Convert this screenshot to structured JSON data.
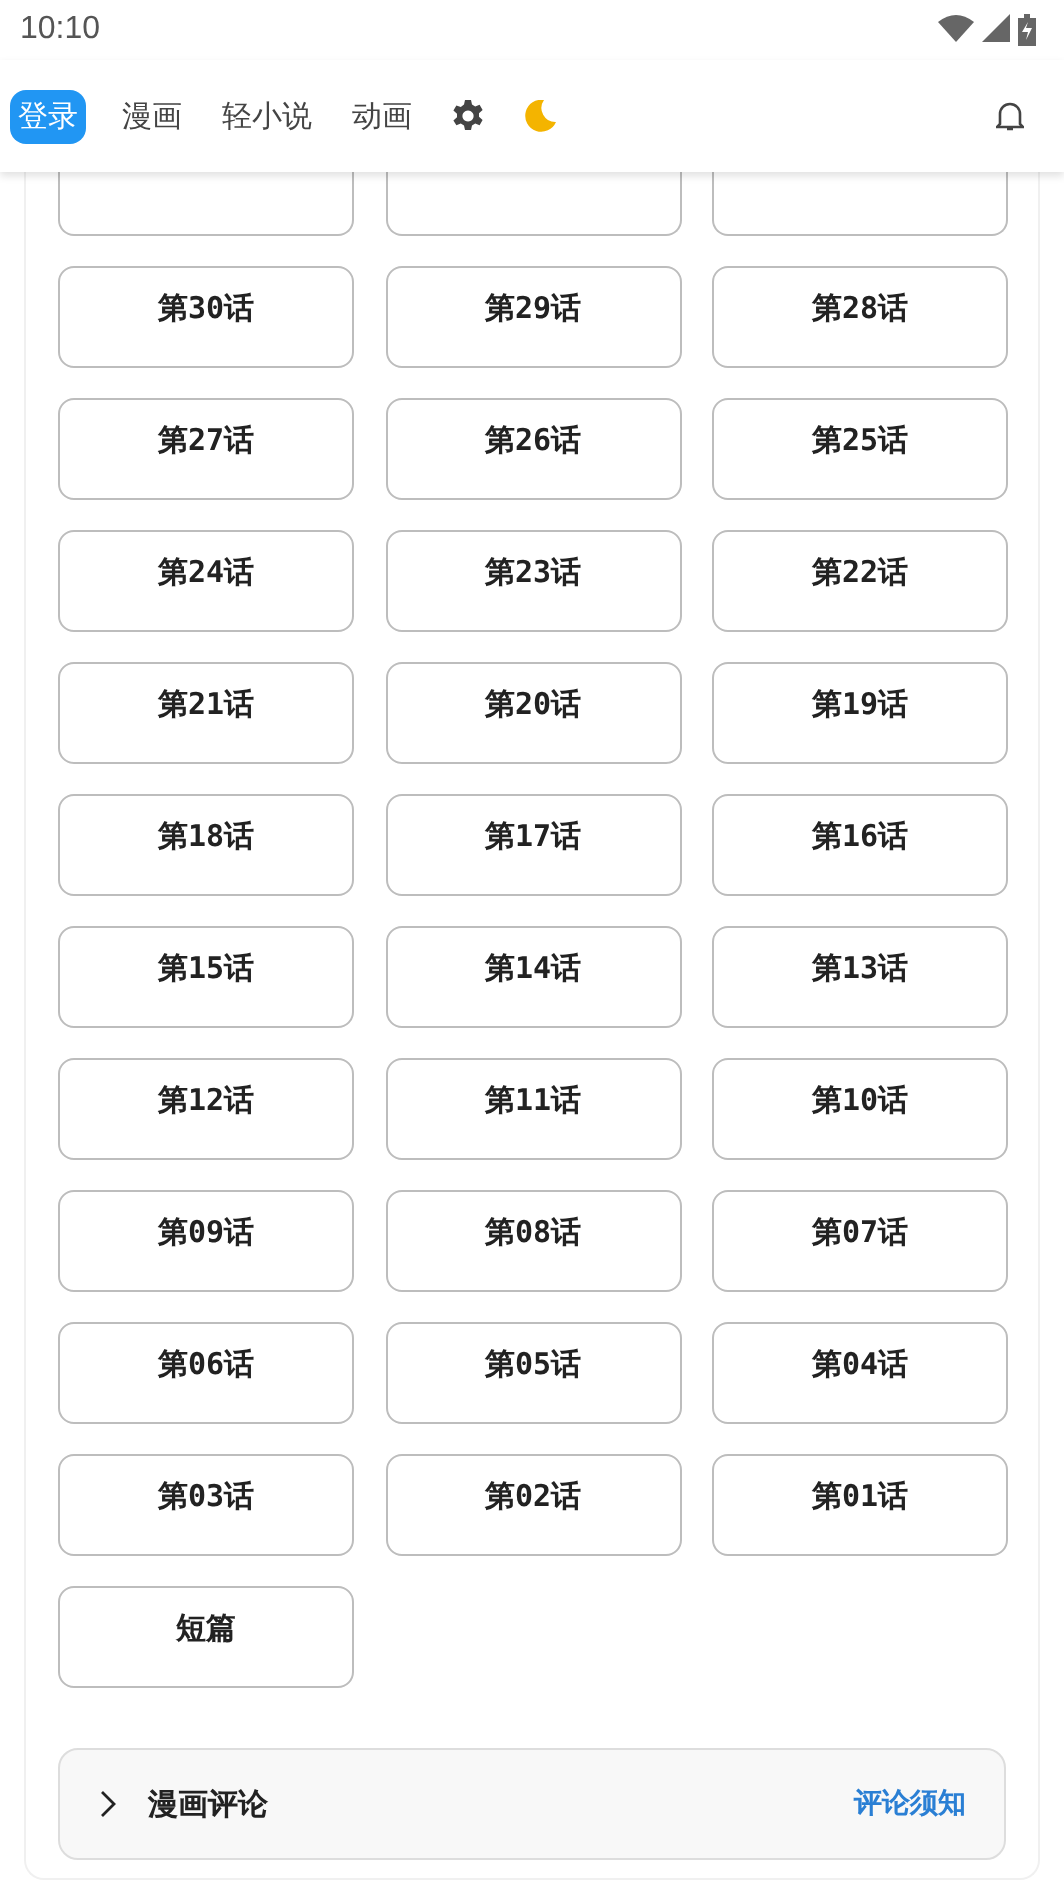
{
  "status_bar": {
    "time": "10:10"
  },
  "nav": {
    "items": [
      {
        "kind": "button",
        "label": "登录"
      },
      {
        "kind": "tab",
        "label": "漫画"
      },
      {
        "kind": "tab",
        "label": "轻小说"
      },
      {
        "kind": "tab",
        "label": "动画"
      },
      {
        "kind": "settings"
      },
      {
        "kind": "theme"
      }
    ]
  },
  "episodes": [
    "第30话",
    "第29话",
    "第28话",
    "第27话",
    "第26话",
    "第25话",
    "第24话",
    "第23话",
    "第22话",
    "第21话",
    "第20话",
    "第19话",
    "第18话",
    "第17话",
    "第16话",
    "第15话",
    "第14话",
    "第13话",
    "第12话",
    "第11话",
    "第10话",
    "第09话",
    "第08话",
    "第07话",
    "第06话",
    "第05话",
    "第04话",
    "第03话",
    "第02话",
    "第01话",
    "短篇"
  ],
  "comments": {
    "title": "漫画评论",
    "expanded": false,
    "notice_link": "评论须知"
  }
}
